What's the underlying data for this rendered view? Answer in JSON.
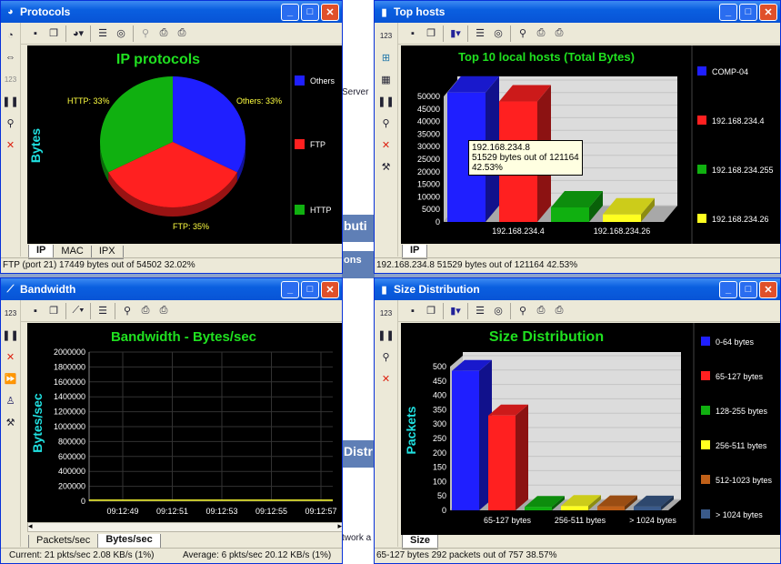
{
  "background": {
    "rows": [
      {
        "top": 73,
        "text": "Server"
      },
      {
        "top": 394,
        "text": ""
      }
    ],
    "bands": [
      {
        "top": 236,
        "text": "buti"
      },
      {
        "top": 280,
        "text": "ons"
      },
      {
        "top": 484,
        "text": "Distr"
      }
    ],
    "bottom_row": "twork a"
  },
  "protocols": {
    "title": "Protocols",
    "chart_title": "IP protocols",
    "ylabel": "Bytes",
    "tabs": [
      "IP",
      "MAC",
      "IPX"
    ],
    "active_tab": "IP",
    "status": "FTP (port 21) 17449 bytes out of 54502 32.02%",
    "legend": [
      {
        "label": "Others",
        "color": "#1f1fff"
      },
      {
        "label": "FTP",
        "color": "#ff2020"
      },
      {
        "label": "HTTP",
        "color": "#10b010"
      }
    ],
    "slice_labels": {
      "http": "HTTP: 33%",
      "others": "Others: 33%",
      "ftp": "FTP: 35%"
    }
  },
  "tophosts": {
    "title": "Top hosts",
    "chart_title": "Top 10  local hosts  (Total Bytes)",
    "tabs": [
      "IP"
    ],
    "status": "192.168.234.8  51529 bytes out of 121164 42.53%",
    "tooltip": [
      "192.168.234.8",
      "51529 bytes out of 121164",
      "42.53%"
    ],
    "yticks": [
      "50000",
      "45000",
      "40000",
      "35000",
      "30000",
      "25000",
      "20000",
      "15000",
      "10000",
      "5000",
      "0"
    ],
    "xlabels": [
      "192.168.234.4",
      "192.168.234.26"
    ],
    "legend": [
      {
        "label": "COMP-04",
        "color": "#1f1fff"
      },
      {
        "label": "192.168.234.4",
        "color": "#ff2020"
      },
      {
        "label": "192.168.234.255",
        "color": "#10b010"
      },
      {
        "label": "192.168.234.26",
        "color": "#ffff20"
      }
    ]
  },
  "bandwidth": {
    "title": "Bandwidth",
    "chart_title": "Bandwidth - Bytes/sec",
    "ylabel": "Bytes/sec",
    "yticks": [
      "2000000",
      "1800000",
      "1600000",
      "1400000",
      "1200000",
      "1000000",
      "800000",
      "600000",
      "400000",
      "200000",
      "0"
    ],
    "xticks": [
      "09:12:49",
      "09:12:51",
      "09:12:53",
      "09:12:55",
      "09:12:57"
    ],
    "tabs": [
      "Packets/sec",
      "Bytes/sec"
    ],
    "active_tab": "Bytes/sec",
    "status_current": "Current: 21 pkts/sec 2.08 KB/s (1%)",
    "status_average": "Average: 6 pkts/sec 20.12 KB/s (1%)"
  },
  "size": {
    "title": "Size Distribution",
    "chart_title": "Size Distribution",
    "ylabel": "Packets",
    "yticks": [
      "500",
      "450",
      "400",
      "350",
      "300",
      "250",
      "200",
      "150",
      "100",
      "50",
      "0"
    ],
    "xlabels": [
      "65-127 bytes",
      "256-511 bytes",
      "> 1024 bytes"
    ],
    "tabs": [
      "Size"
    ],
    "status": "65-127 bytes 292 packets out of 757 38.57%",
    "legend": [
      {
        "label": "0-64 bytes",
        "color": "#1f1fff"
      },
      {
        "label": "65-127 bytes",
        "color": "#ff2020"
      },
      {
        "label": "128-255 bytes",
        "color": "#10b010"
      },
      {
        "label": "256-511 bytes",
        "color": "#ffff20"
      },
      {
        "label": "512-1023 bytes",
        "color": "#c06018"
      },
      {
        "label": "> 1024 bytes",
        "color": "#3a5a8a"
      }
    ]
  },
  "chart_data": [
    {
      "type": "pie",
      "title": "IP protocols",
      "ylabel": "Bytes",
      "categories": [
        "Others",
        "FTP",
        "HTTP"
      ],
      "values": [
        33,
        35,
        33
      ],
      "unit": "%"
    },
    {
      "type": "bar",
      "title": "Top 10  local hosts  (Total Bytes)",
      "categories": [
        "COMP-04",
        "192.168.234.4",
        "192.168.234.255",
        "192.168.234.26"
      ],
      "values": [
        51529,
        48000,
        5800,
        3000
      ],
      "ylim": [
        0,
        50000
      ]
    },
    {
      "type": "line",
      "title": "Bandwidth - Bytes/sec",
      "ylabel": "Bytes/sec",
      "x": [
        "09:12:49",
        "09:12:51",
        "09:12:53",
        "09:12:55",
        "09:12:57"
      ],
      "values": [
        2080,
        2080,
        2080,
        2080,
        2080
      ],
      "ylim": [
        0,
        2000000
      ]
    },
    {
      "type": "bar",
      "title": "Size Distribution",
      "ylabel": "Packets",
      "categories": [
        "0-64 bytes",
        "65-127 bytes",
        "128-255 bytes",
        "256-511 bytes",
        "512-1023 bytes",
        "> 1024 bytes"
      ],
      "values": [
        485,
        330,
        12,
        15,
        14,
        13
      ],
      "ylim": [
        0,
        500
      ]
    }
  ]
}
